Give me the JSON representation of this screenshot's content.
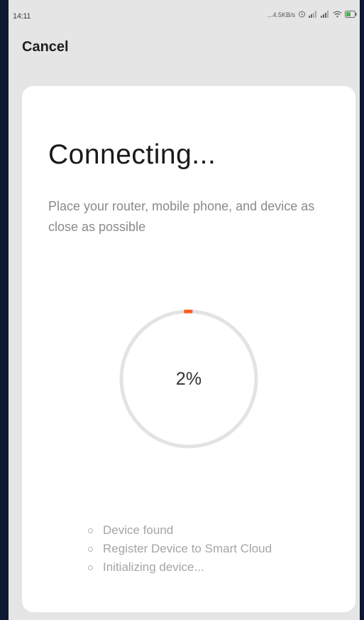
{
  "status_bar": {
    "time": "14:11",
    "network_speed": "...4.5KB/s",
    "icons": [
      "alarm-icon",
      "signal-icon-1",
      "signal-icon-2",
      "wifi-icon",
      "battery-icon"
    ]
  },
  "header": {
    "cancel_label": "Cancel"
  },
  "main": {
    "title": "Connecting...",
    "subtitle": "Place your router, mobile phone, and device as close as possible",
    "progress": {
      "percent_label": "2%",
      "percent": 2,
      "accent_color": "#ff5a1f",
      "track_color": "#e3e3e3"
    },
    "steps": [
      {
        "label": "Device found"
      },
      {
        "label": "Register Device to Smart Cloud"
      },
      {
        "label": "Initializing device..."
      }
    ]
  }
}
